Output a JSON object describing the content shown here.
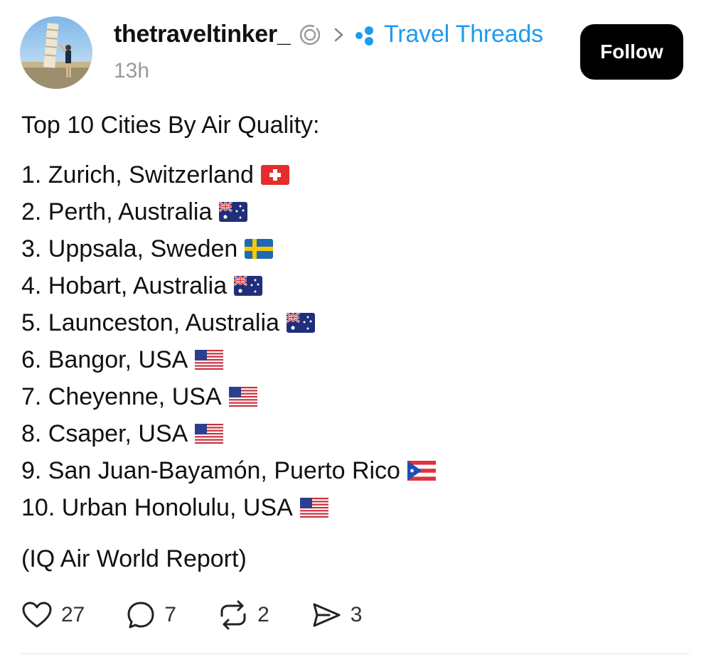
{
  "post": {
    "username": "thetraveltinker_",
    "community": "Travel Threads",
    "timestamp": "13h",
    "follow_label": "Follow",
    "heading": "Top 10 Cities By Air Quality:",
    "items": [
      {
        "text": "1. Zurich, Switzerland",
        "flag": "switzerland-flag-icon"
      },
      {
        "text": "2. Perth, Australia",
        "flag": "australia-flag-icon"
      },
      {
        "text": "3. Uppsala, Sweden",
        "flag": "sweden-flag-icon"
      },
      {
        "text": "4. Hobart, Australia",
        "flag": "australia-flag-icon"
      },
      {
        "text": "5. Launceston, Australia",
        "flag": "australia-flag-icon"
      },
      {
        "text": "6. Bangor, USA",
        "flag": "usa-flag-icon"
      },
      {
        "text": "7. Cheyenne, USA",
        "flag": "usa-flag-icon"
      },
      {
        "text": "8. Csaper, USA",
        "flag": "usa-flag-icon"
      },
      {
        "text": "9. San Juan-Bayamón, Puerto Rico",
        "flag": "puerto-rico-flag-icon"
      },
      {
        "text": "10. Urban Honolulu, USA",
        "flag": "usa-flag-icon"
      }
    ],
    "source": "(IQ Air World Report)"
  },
  "actions": {
    "likes": "27",
    "replies": "7",
    "reposts": "2",
    "shares": "3"
  },
  "colors": {
    "community_link": "#1d9bf0",
    "follow_bg": "#000000",
    "timestamp": "#999999"
  },
  "icons": [
    "verified-badge-icon",
    "chevron-right-icon",
    "threads-community-icon",
    "heart-icon",
    "reply-icon",
    "repost-icon",
    "share-icon"
  ]
}
